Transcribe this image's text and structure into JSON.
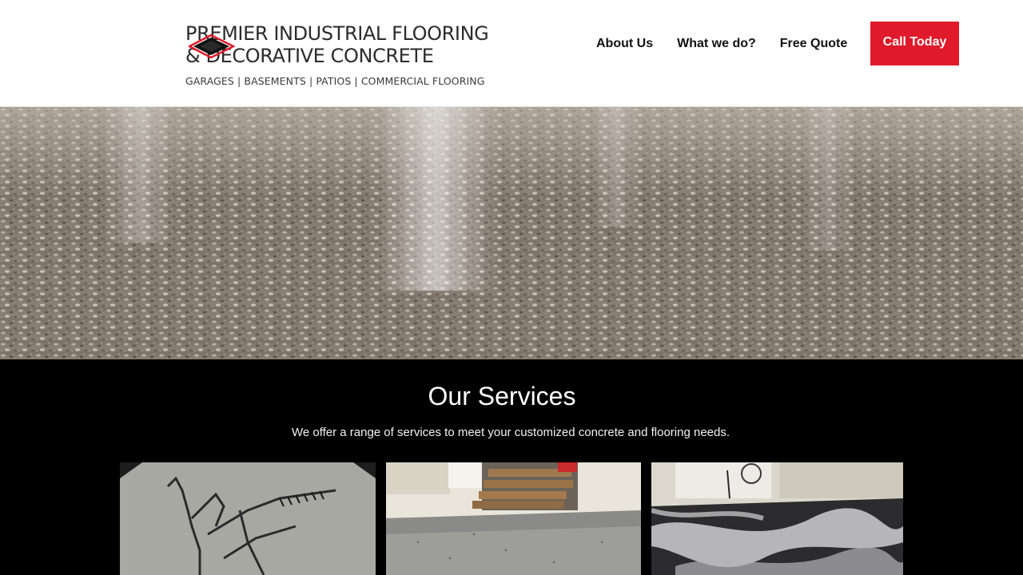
{
  "header": {
    "brand_line1": "PREMIER INDUSTRIAL FLOORING",
    "brand_line2": "& DECORATIVE CONCRETE",
    "tagline": "GARAGES | BASEMENTS | PATIOS | COMMERCIAL FLOORING",
    "logo_icon": "diamond-logo-icon",
    "nav": [
      {
        "label": "About Us"
      },
      {
        "label": "What we do?"
      },
      {
        "label": "Free Quote"
      }
    ],
    "cta_label": "Call Today",
    "accent_color": "#e01a2a"
  },
  "hero": {
    "image": "polished-terrazzo-floor-photo"
  },
  "services": {
    "title": "Our Services",
    "subtitle": "We offer a range of services to meet your customized concrete and flooring needs.",
    "cards": [
      {
        "image": "skeleton-hand-comb-scissors-engraving-photo"
      },
      {
        "image": "flake-epoxy-basement-stairs-photo"
      },
      {
        "image": "metallic-epoxy-garage-floor-photo"
      }
    ]
  }
}
